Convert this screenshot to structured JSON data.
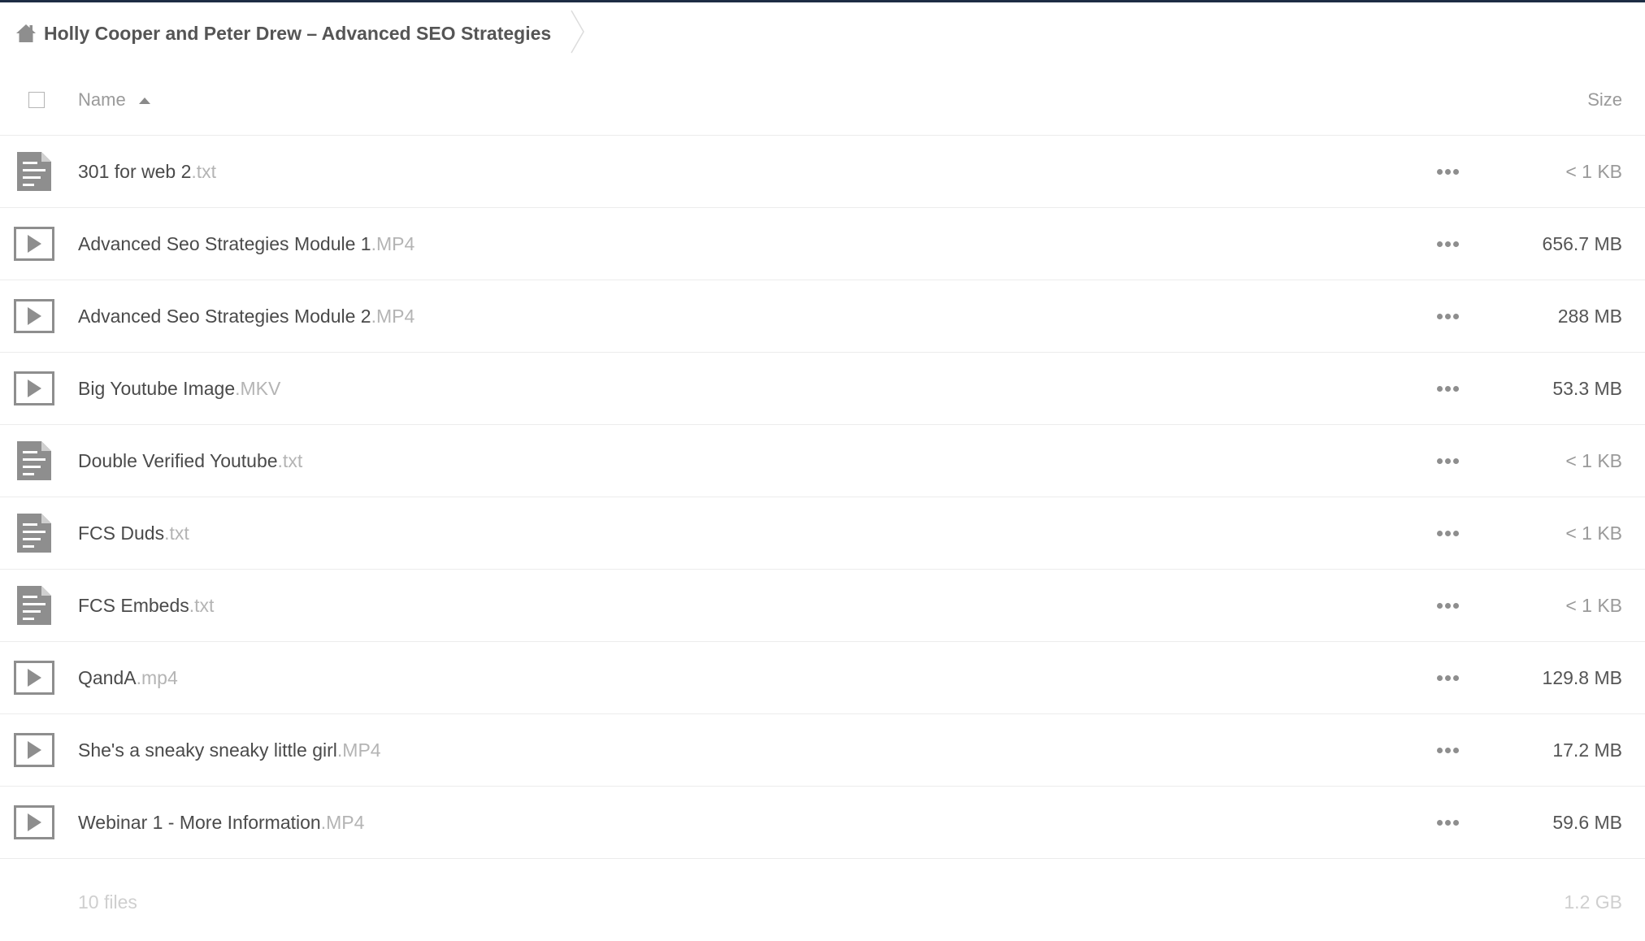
{
  "breadcrumb": {
    "home_icon": "home-icon",
    "folder": "Holly Cooper and Peter Drew – Advanced SEO Strategies"
  },
  "header": {
    "name_label": "Name",
    "sort_direction": "ascending",
    "size_label": "Size"
  },
  "files": [
    {
      "base": "301 for web 2",
      "ext": ".txt",
      "type": "text",
      "icon": "text-file-icon",
      "size": "< 1 KB"
    },
    {
      "base": "Advanced Seo Strategies Module 1",
      "ext": ".MP4",
      "type": "video",
      "icon": "video-file-icon",
      "size": "656.7 MB"
    },
    {
      "base": "Advanced Seo Strategies Module 2",
      "ext": ".MP4",
      "type": "video",
      "icon": "video-file-icon",
      "size": "288 MB"
    },
    {
      "base": "Big Youtube Image",
      "ext": ".MKV",
      "type": "video",
      "icon": "video-file-icon",
      "size": "53.3 MB"
    },
    {
      "base": "Double Verified Youtube",
      "ext": ".txt",
      "type": "text",
      "icon": "text-file-icon",
      "size": "< 1 KB"
    },
    {
      "base": "FCS Duds",
      "ext": ".txt",
      "type": "text",
      "icon": "text-file-icon",
      "size": "< 1 KB"
    },
    {
      "base": "FCS Embeds",
      "ext": ".txt",
      "type": "text",
      "icon": "text-file-icon",
      "size": "< 1 KB"
    },
    {
      "base": "QandA",
      "ext": ".mp4",
      "type": "video",
      "icon": "video-file-icon",
      "size": "129.8 MB"
    },
    {
      "base": "She's a sneaky sneaky little girl",
      "ext": ".MP4",
      "type": "video",
      "icon": "video-file-icon",
      "size": "17.2 MB"
    },
    {
      "base": "Webinar 1 - More Information",
      "ext": ".MP4",
      "type": "video",
      "icon": "video-file-icon",
      "size": "59.6 MB"
    }
  ],
  "summary": {
    "count": "10 files",
    "total_size": "1.2 GB"
  },
  "colors": {
    "top_bar": "#1d2d44",
    "icon_gray": "#8e8e8e",
    "text": "#4a4a4a",
    "extension": "#b4b4b4",
    "header_text": "#9a9a9a"
  }
}
